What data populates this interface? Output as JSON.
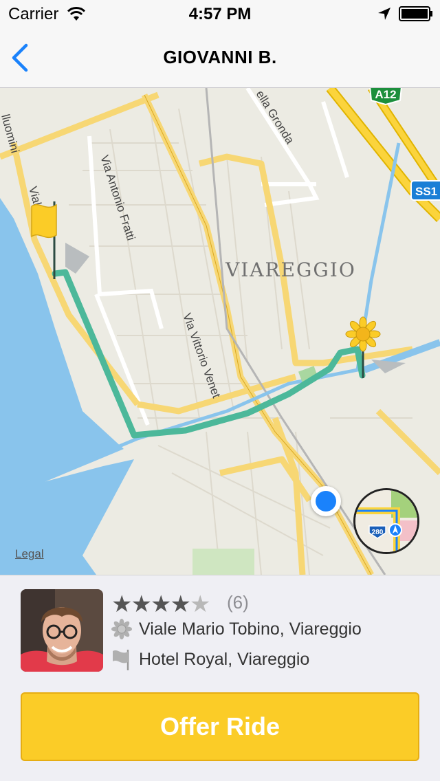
{
  "status_bar": {
    "carrier": "Carrier",
    "time": "4:57 PM"
  },
  "nav": {
    "title": "GIOVANNI B.",
    "back_icon": "chevron-left-icon"
  },
  "map": {
    "city_label": "Viareggio",
    "street_labels": [
      "Via Antonio Fratti",
      "Via Vittorio Venet",
      "ella Gronda",
      "lluomini",
      "Viale"
    ],
    "road_shields": [
      "A12",
      "SS1"
    ],
    "flyover_shield": "280",
    "legal": "Legal",
    "route_color": "#4cb89a",
    "water_color": "#89c4ec"
  },
  "driver": {
    "rating": 4,
    "rating_max": 5,
    "rating_count": "(6)",
    "pickup": "Viale Mario Tobino, Viareggio",
    "dropoff": "Hotel Royal, Viareggio",
    "pickup_icon": "sun-icon",
    "dropoff_icon": "flag-icon"
  },
  "actions": {
    "offer_label": "Offer Ride",
    "accent": "#fbcc27"
  }
}
